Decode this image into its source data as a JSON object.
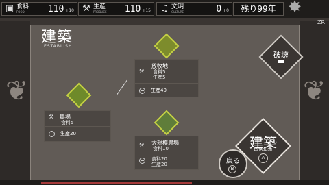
{
  "resources": [
    {
      "icon": "food-icon",
      "glyph": "🍞",
      "label": "食料",
      "sub": "FOOD",
      "value": "110",
      "gain": "+10"
    },
    {
      "icon": "production-icon",
      "glyph": "⚒",
      "label": "生産",
      "sub": "PRODUCE",
      "value": "110",
      "gain": "+15"
    },
    {
      "icon": "culture-icon",
      "glyph": "♫",
      "label": "文明",
      "sub": "CULTURE",
      "value": "0",
      "gain": "+0"
    }
  ],
  "years_left": "残り99年",
  "corner_label": "ZR",
  "title": "建築",
  "subtitle": "ESTABLISH",
  "buildings": {
    "farm": {
      "name": "農場",
      "cost_line1": "食料5",
      "production": "生産20"
    },
    "pasture": {
      "name": "放牧地",
      "cost_line1": "食料5",
      "cost_line2": "生産5",
      "production": "生産40"
    },
    "large_farm": {
      "name": "大規模農場",
      "cost_line1": "食料10",
      "production1": "食料20",
      "production2": "生産20"
    }
  },
  "buttons": {
    "destroy": "破壊",
    "back": "戻る",
    "back_key": "B",
    "build": "建築",
    "build_sub": "ESTABLISH",
    "build_key": "A"
  }
}
